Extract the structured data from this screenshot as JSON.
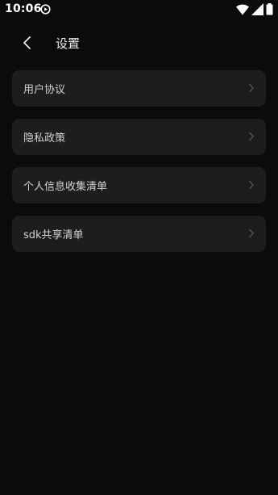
{
  "status_bar": {
    "time": "10:06",
    "icons": [
      "play-icon",
      "wifi-icon",
      "signal-icon",
      "battery-icon"
    ]
  },
  "header": {
    "back_icon": "chevron-left-icon",
    "title": "设置"
  },
  "menu": {
    "items": [
      {
        "label": "用户协议",
        "icon": "chevron-right-icon"
      },
      {
        "label": "隐私政策",
        "icon": "chevron-right-icon"
      },
      {
        "label": "个人信息收集清单",
        "icon": "chevron-right-icon"
      },
      {
        "label": "sdk共享清单",
        "icon": "chevron-right-icon"
      }
    ]
  },
  "colors": {
    "background": "#0b0b0b",
    "card": "#1d1d1d",
    "text": "#d2d2d2",
    "chevron": "#5c5c5c"
  }
}
